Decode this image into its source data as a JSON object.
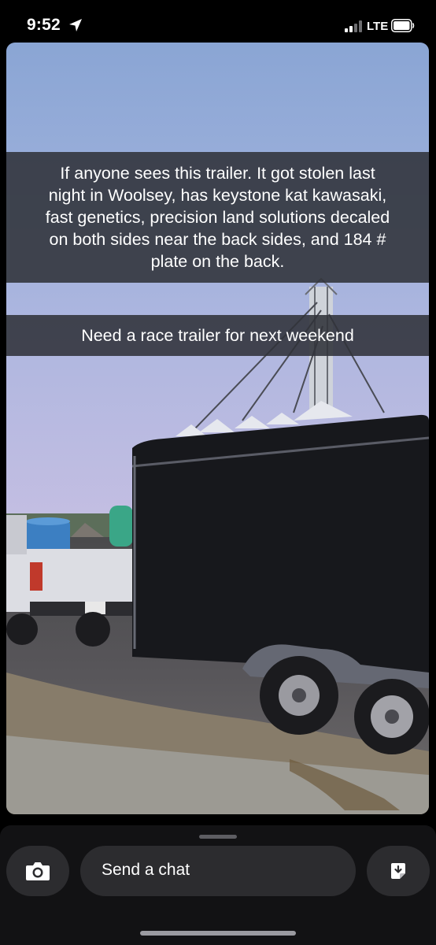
{
  "status_bar": {
    "time": "9:52",
    "network": "LTE",
    "location_icon": "location-arrow-icon",
    "signal_icon": "signal-bars-icon",
    "battery_icon": "battery-icon"
  },
  "snap": {
    "caption_lines": [
      "If anyone sees this trailer. It got stolen last",
      "night in Woolsey, has keystone kat kawasaki,",
      "fast genetics, precision land solutions decaled",
      "on both sides near the back sides, and 184 #",
      "plate on the back."
    ],
    "caption_2": "Need a race trailer for next weekend"
  },
  "chat_bar": {
    "placeholder": "Send a chat",
    "camera_icon": "camera-icon",
    "sticker_icon": "sticker-icon"
  },
  "colors": {
    "background": "#000000",
    "chat_bar_bg": "#121214",
    "pill_bg": "#2c2c2f",
    "caption_bg": "#303239"
  }
}
